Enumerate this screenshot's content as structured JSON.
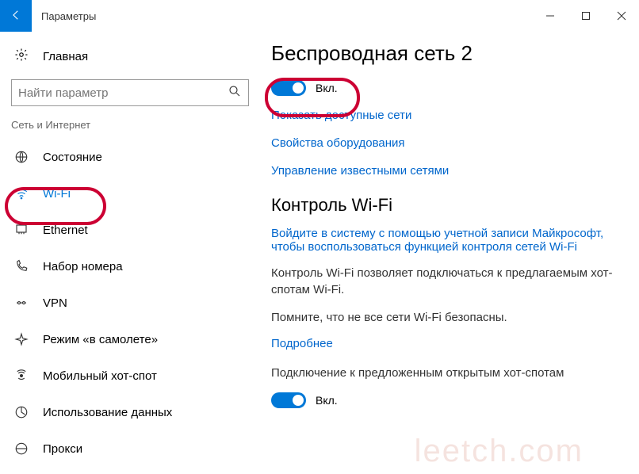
{
  "titlebar": {
    "title": "Параметры"
  },
  "sidebar": {
    "home": "Главная",
    "search_placeholder": "Найти параметр",
    "category": "Сеть и Интернет",
    "items": [
      {
        "label": "Состояние"
      },
      {
        "label": "Wi-Fi"
      },
      {
        "label": "Ethernet"
      },
      {
        "label": "Набор номера"
      },
      {
        "label": "VPN"
      },
      {
        "label": "Режим «в самолете»"
      },
      {
        "label": "Мобильный хот-спот"
      },
      {
        "label": "Использование данных"
      },
      {
        "label": "Прокси"
      }
    ]
  },
  "main": {
    "h1": "Беспроводная сеть 2",
    "toggle1_label": "Вкл.",
    "link_show_networks": "Показать доступные сети",
    "link_hw_props": "Свойства оборудования",
    "link_known": "Управление известными сетями",
    "h2": "Контроль Wi-Fi",
    "link_signin": "Войдите в систему с помощью учетной записи Майкрософт, чтобы воспользоваться функцией контроля сетей Wi-Fi",
    "body1": "Контроль Wi-Fi позволяет подключаться к предлагаемым хот-спотам Wi-Fi.",
    "body2": "Помните, что не все сети Wi-Fi безопасны.",
    "link_more": "Подробнее",
    "body3": "Подключение к предложенным открытым хот-спотам",
    "toggle2_label": "Вкл."
  },
  "watermark": "leetch.com"
}
